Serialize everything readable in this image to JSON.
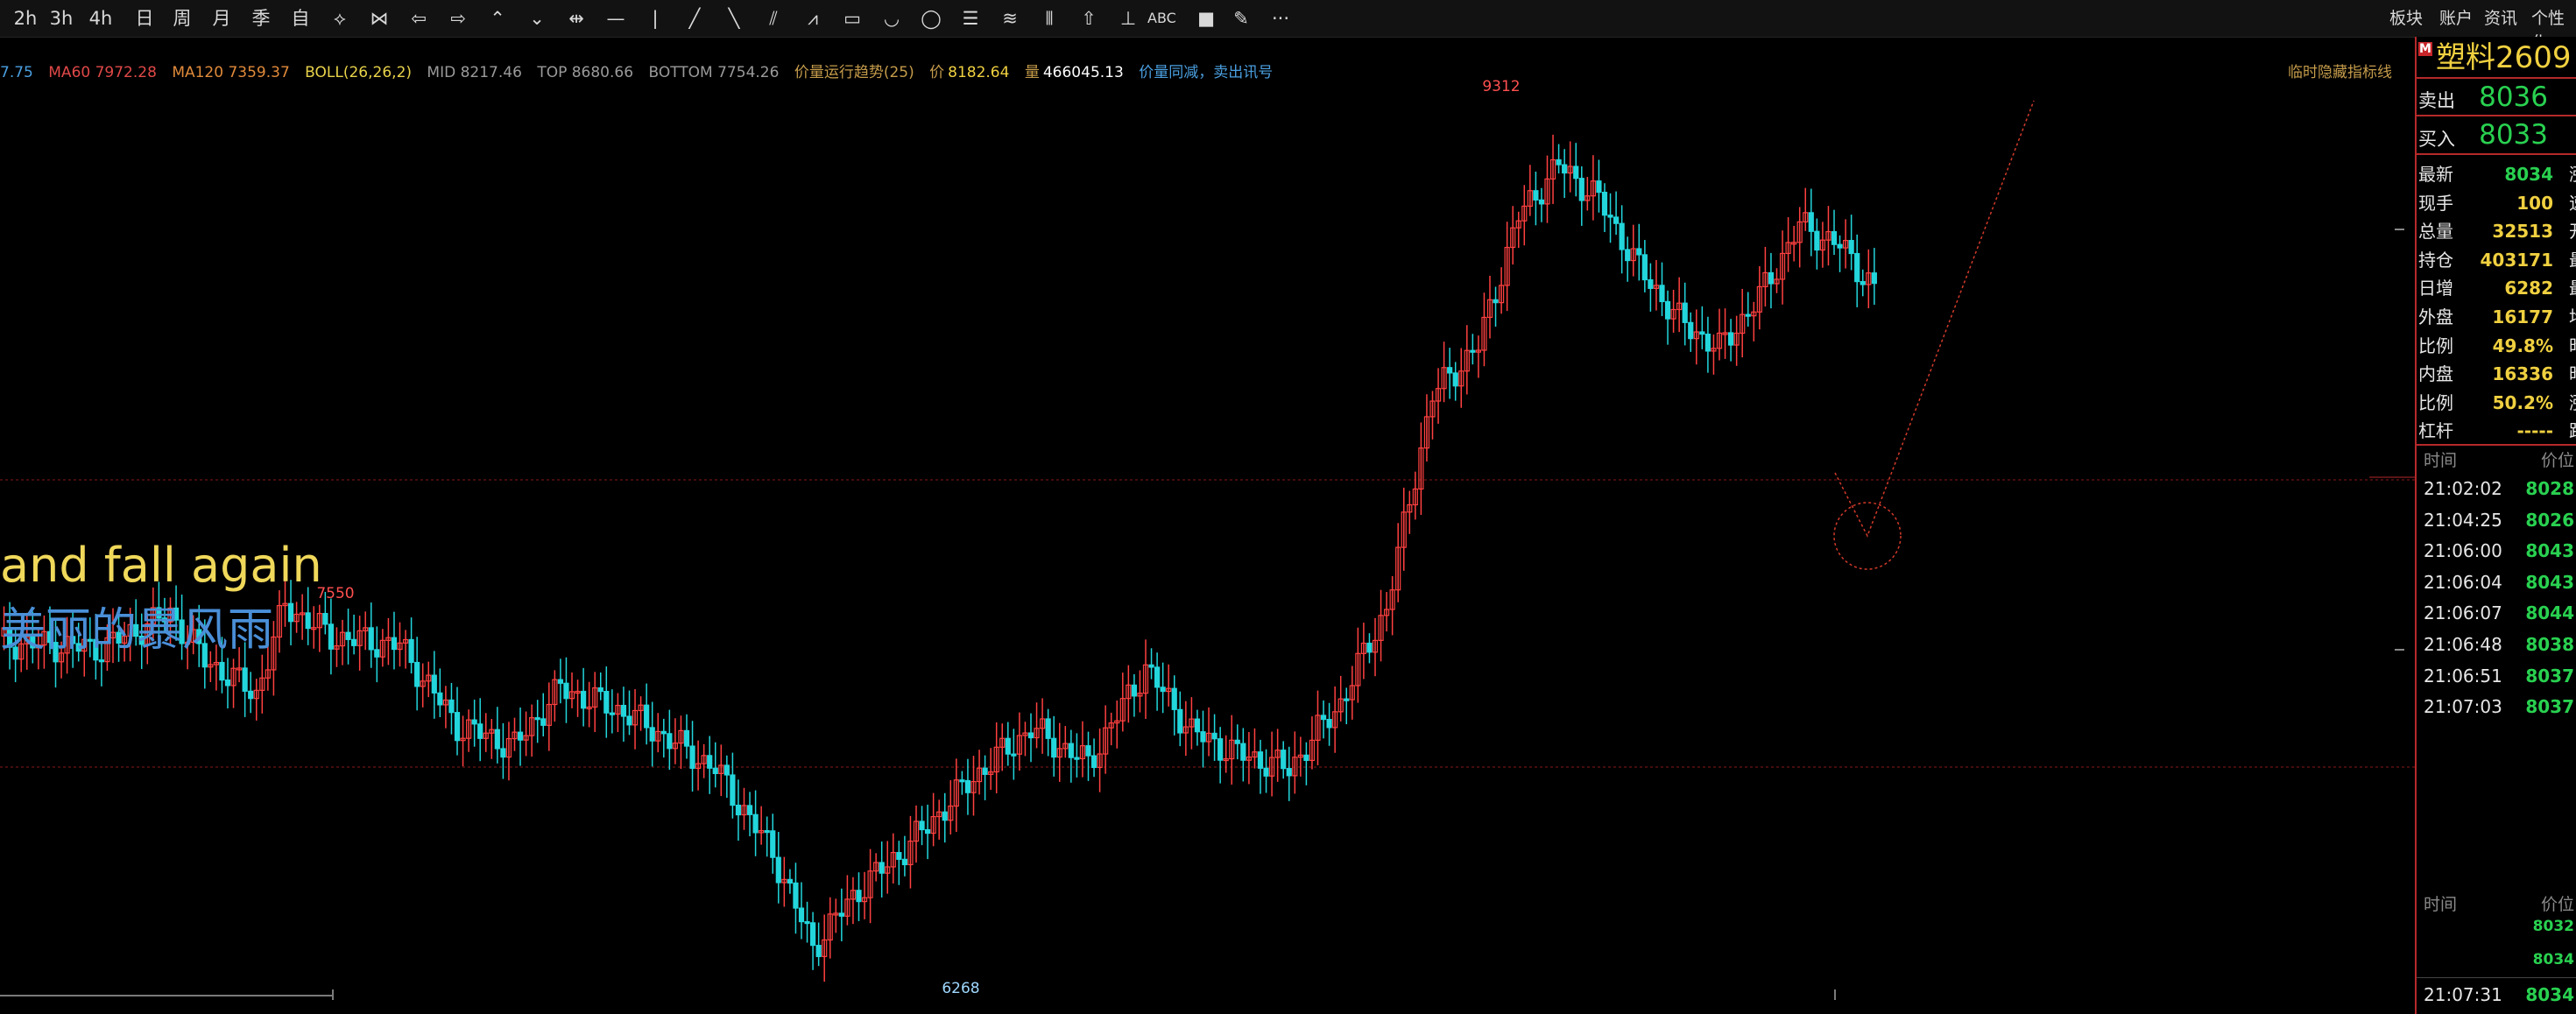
{
  "toolbar": {
    "buttons": [
      {
        "label": "2h",
        "icon": "period-2h-icon"
      },
      {
        "label": "3h",
        "icon": "period-3h-icon"
      },
      {
        "label": "4h",
        "icon": "period-4h-icon"
      },
      {
        "label": "日",
        "icon": "period-day-icon"
      },
      {
        "label": "周",
        "icon": "period-week-icon"
      },
      {
        "label": "月",
        "icon": "period-month-icon"
      },
      {
        "label": "季",
        "icon": "period-quarter-icon"
      },
      {
        "label": "自",
        "icon": "period-custom-icon"
      },
      {
        "label": "⟡",
        "icon": "diamond-tool-icon"
      },
      {
        "label": "⋈",
        "icon": "bowtie-tool-icon"
      },
      {
        "label": "⇦",
        "icon": "arrow-left-icon"
      },
      {
        "label": "⇨",
        "icon": "arrow-right-icon"
      },
      {
        "label": "⌃",
        "icon": "chevron-up-icon"
      },
      {
        "label": "⌄",
        "icon": "chevron-down-icon"
      },
      {
        "label": "⇹",
        "icon": "crosshair-tool-icon"
      },
      {
        "label": "—",
        "icon": "horizontal-line-icon"
      },
      {
        "label": "|",
        "icon": "vertical-line-icon"
      },
      {
        "label": "╱",
        "icon": "trend-line-icon"
      },
      {
        "label": "╲",
        "icon": "ray-line-icon"
      },
      {
        "label": "⫽",
        "icon": "parallel-lines-icon"
      },
      {
        "label": "⩘",
        "icon": "wave-tool-icon"
      },
      {
        "label": "▭",
        "icon": "rectangle-tool-icon"
      },
      {
        "label": "◡",
        "icon": "arc-tool-icon"
      },
      {
        "label": "◯",
        "icon": "circle-tool-icon"
      },
      {
        "label": "☰",
        "icon": "fibonacci-tool-icon"
      },
      {
        "label": "≋",
        "icon": "gann-tool-icon"
      },
      {
        "label": "⫴",
        "icon": "cycle-lines-icon"
      },
      {
        "label": "⇧",
        "icon": "up-arrow-marker-icon"
      },
      {
        "label": "⊥",
        "icon": "measure-tool-icon"
      },
      {
        "label": "ABC",
        "icon": "text-annotation-icon"
      },
      {
        "label": "■",
        "icon": "fill-color-icon"
      },
      {
        "label": "✎",
        "icon": "pen-tool-icon"
      },
      {
        "label": "···",
        "icon": "more-icon"
      }
    ],
    "menu": [
      "板块",
      "账户",
      "资讯",
      "个性化"
    ]
  },
  "indicator": {
    "prefix": "7.75",
    "ma60": "MA60 7972.28",
    "ma120": "MA120 7359.37",
    "boll": "BOLL(26,26,2)",
    "mid": "MID 8217.46",
    "top": "TOP 8680.66",
    "bottom": "BOTTOM 7754.26",
    "trend": "价量运行趋势(25)",
    "price_label": "价",
    "price_value": "8182.64",
    "volume_label": "量",
    "volume_value": "466045.13",
    "signal": "价量同减，卖出讯号",
    "hide_label": "临时隐藏指标线"
  },
  "overlay": {
    "line1": "and fall again",
    "line2": "美丽的暴风雨"
  },
  "chart_data": {
    "type": "candlestick",
    "annotations": [
      {
        "label": "9312",
        "value": 9312
      },
      {
        "label": "7550",
        "value": 7550
      },
      {
        "label": "6268",
        "value": 6268
      }
    ],
    "colors": {
      "up": "#ff4040",
      "down": "#22d6dc",
      "background": "#000000"
    }
  },
  "side_panel": {
    "badge": "M",
    "contract": "塑料2609",
    "sell_label": "卖出",
    "sell_price": "8036",
    "buy_label": "买入",
    "buy_price": "8033",
    "quote_rows": [
      {
        "label": "最新",
        "value": "8034",
        "value_color": "#29d150",
        "cut": "涨"
      },
      {
        "label": "现手",
        "value": "100",
        "value_color": "#f0d040",
        "cut": "速"
      },
      {
        "label": "总量",
        "value": "32513",
        "value_color": "#f0d040",
        "cut": "开"
      },
      {
        "label": "持仓",
        "value": "403171",
        "value_color": "#f0d040",
        "cut": "最"
      },
      {
        "label": "日增",
        "value": "6282",
        "value_color": "#f0d040",
        "cut": "最"
      },
      {
        "label": "外盘",
        "value": "16177",
        "value_color": "#f0d040",
        "cut": "均"
      },
      {
        "label": "比例",
        "value": "49.8%",
        "value_color": "#f0d040",
        "cut": "昨"
      },
      {
        "label": "内盘",
        "value": "16336",
        "value_color": "#f0d040",
        "cut": "昨"
      },
      {
        "label": "比例",
        "value": "50.2%",
        "value_color": "#f0d040",
        "cut": "涨"
      },
      {
        "label": "杠杆",
        "value": "-----",
        "value_color": "#f0d040",
        "cut": "跌"
      }
    ],
    "tick_header": {
      "time": "时间",
      "price": "价位"
    },
    "ticks": [
      {
        "time": "21:02:02",
        "price": "8028"
      },
      {
        "time": "21:04:25",
        "price": "8026"
      },
      {
        "time": "21:06:00",
        "price": "8043"
      },
      {
        "time": "21:06:04",
        "price": "8043"
      },
      {
        "time": "21:06:07",
        "price": "8044"
      },
      {
        "time": "21:06:48",
        "price": "8038"
      },
      {
        "time": "21:06:51",
        "price": "8037"
      },
      {
        "time": "21:07:03",
        "price": "8037"
      }
    ],
    "lower_header": {
      "time": "时间",
      "price": "价位"
    },
    "lower_values": [
      "8032",
      "8034"
    ],
    "last_tick": {
      "time": "21:07:31",
      "price": "8034"
    }
  }
}
